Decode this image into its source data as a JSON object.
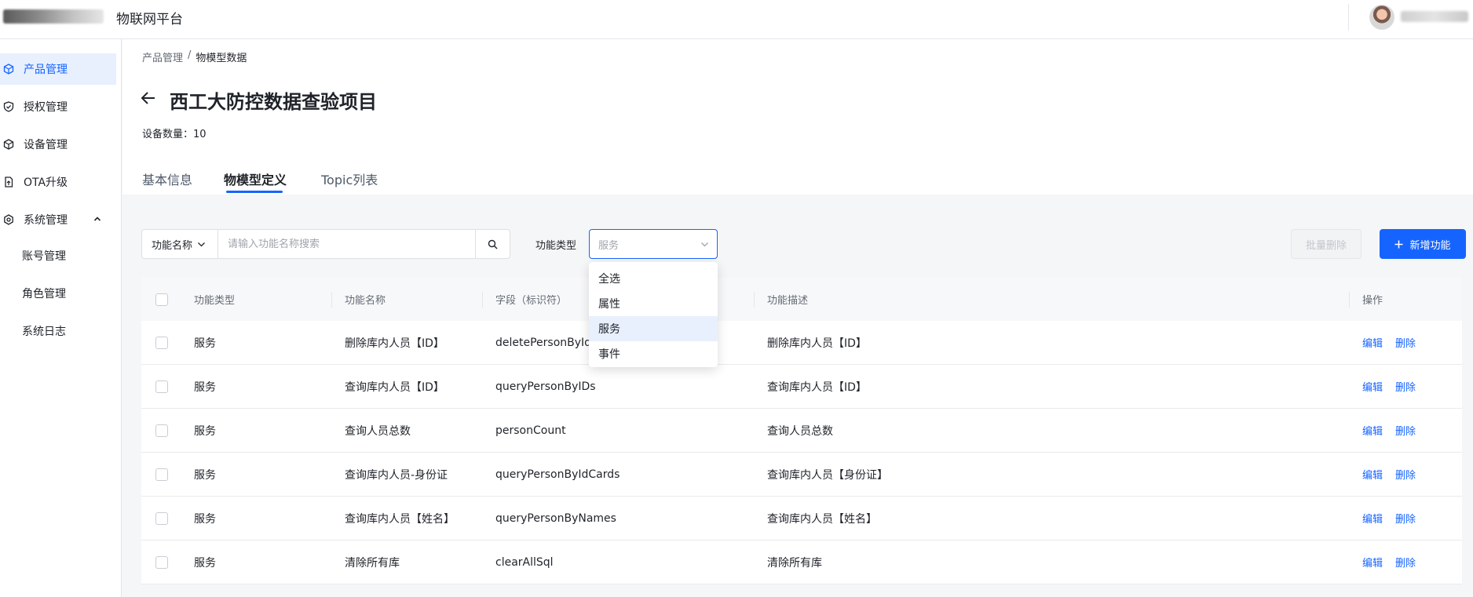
{
  "header": {
    "app_title": "物联网平台"
  },
  "sidebar": {
    "items": [
      {
        "label": "产品管理",
        "icon": "product-icon"
      },
      {
        "label": "授权管理",
        "icon": "shield-check-icon"
      },
      {
        "label": "设备管理",
        "icon": "cube-icon"
      },
      {
        "label": "OTA升级",
        "icon": "file-upgrade-icon"
      },
      {
        "label": "系统管理",
        "icon": "gear-icon"
      }
    ],
    "sub_items": [
      {
        "label": "账号管理"
      },
      {
        "label": "角色管理"
      },
      {
        "label": "系统日志"
      }
    ]
  },
  "breadcrumb": {
    "parent": "产品管理",
    "separator": "/",
    "current": "物模型数据"
  },
  "page": {
    "title": "西工大防控数据查验项目",
    "device_count": "设备数量：10"
  },
  "tabs": [
    {
      "label": "基本信息"
    },
    {
      "label": "物模型定义"
    },
    {
      "label": "Topic列表"
    }
  ],
  "toolbar": {
    "search_field": "功能名称",
    "search_placeholder": "请输入功能名称搜索",
    "filter_label": "功能类型",
    "filter_placeholder": "服务",
    "batch_delete": "批量删除",
    "add_button": "新增功能"
  },
  "dropdown": {
    "options": [
      {
        "label": "全选"
      },
      {
        "label": "属性"
      },
      {
        "label": "服务"
      },
      {
        "label": "事件"
      }
    ]
  },
  "table": {
    "headers": {
      "type": "功能类型",
      "name": "功能名称",
      "identifier": "字段（标识符）",
      "desc": "功能描述",
      "ops": "操作"
    },
    "ops": {
      "edit": "编辑",
      "delete": "删除"
    },
    "rows": [
      {
        "type": "服务",
        "name": "删除库内人员【ID】",
        "identifier": "deletePersonByIds",
        "desc": "删除库内人员【ID】"
      },
      {
        "type": "服务",
        "name": "查询库内人员【ID】",
        "identifier": "queryPersonByIDs",
        "desc": "查询库内人员【ID】"
      },
      {
        "type": "服务",
        "name": "查询人员总数",
        "identifier": "personCount",
        "desc": "查询人员总数"
      },
      {
        "type": "服务",
        "name": "查询库内人员-身份证",
        "identifier": "queryPersonByIdCards",
        "desc": "查询库内人员【身份证】"
      },
      {
        "type": "服务",
        "name": "查询库内人员【姓名】",
        "identifier": "queryPersonByNames",
        "desc": "查询库内人员【姓名】"
      },
      {
        "type": "服务",
        "name": "清除所有库",
        "identifier": "clearAllSql",
        "desc": "清除所有库"
      }
    ]
  },
  "colors": {
    "primary": "#1664ff",
    "active_bg": "#e8f0fe",
    "page_bg": "#f5f6f7"
  }
}
